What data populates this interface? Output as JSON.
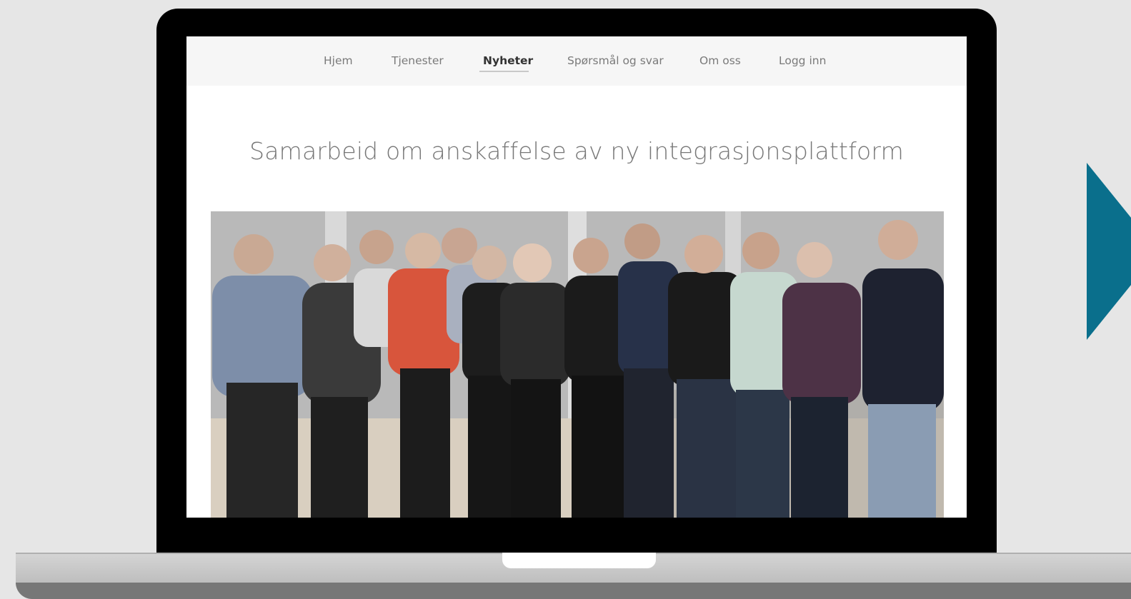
{
  "nav": {
    "items": [
      {
        "label": "Hjem",
        "active": false
      },
      {
        "label": "Tjenester",
        "active": false
      },
      {
        "label": "Nyheter",
        "active": true
      },
      {
        "label": "Spørsmål og svar",
        "active": false
      },
      {
        "label": "Om oss",
        "active": false
      },
      {
        "label": "Logg inn",
        "active": false
      }
    ]
  },
  "article": {
    "title": "Samarbeid om anskaffelse av ny integrasjonsplattform",
    "image_icon": "group-photo"
  },
  "slider": {
    "next_icon": "chevron-right-icon",
    "accent_color": "#0a6f8c"
  }
}
